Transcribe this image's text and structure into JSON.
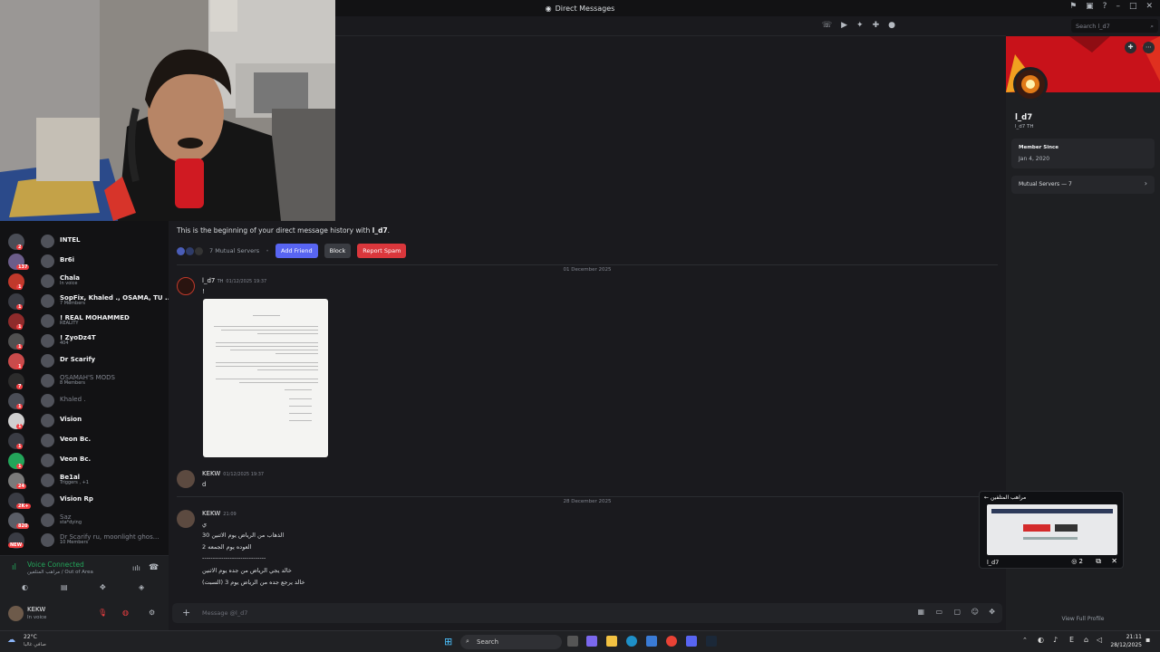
{
  "window": {
    "title": "Direct Messages"
  },
  "header": {
    "search_placeholder": "Search l_d7"
  },
  "sidebar": {
    "dms": [
      {
        "name": "INTEL",
        "status": "",
        "dim": false
      },
      {
        "name": "Br6i",
        "status": "",
        "dim": false
      },
      {
        "name": "Chala",
        "status": "In voice",
        "dim": false
      },
      {
        "name": "SopFix, Khaled ., OSAMA, TU ...",
        "status": "7 Members",
        "dim": false
      },
      {
        "name": "! REAL MOHAMMED",
        "status": "REALITY",
        "dim": false
      },
      {
        "name": "! ZyoDz4T",
        "status": "404",
        "dim": false
      },
      {
        "name": "Dr Scarify",
        "status": "",
        "dim": false
      },
      {
        "name": "OSAMAH'S MODS",
        "status": "8 Members",
        "dim": true
      },
      {
        "name": "Khaled .",
        "status": "",
        "dim": true
      },
      {
        "name": "Vision",
        "status": "",
        "dim": false
      },
      {
        "name": "Veon Bc.",
        "status": "",
        "dim": false
      },
      {
        "name": "Veon Bc.",
        "status": "",
        "dim": false
      },
      {
        "name": "Be1al",
        "status": "Triggers , +1",
        "dim": false
      },
      {
        "name": "Vision Rp",
        "status": "",
        "dim": false
      },
      {
        "name": "Saz",
        "status": "sta*dying",
        "dim": true
      },
      {
        "name": "Dr Scarify ru, moonlight ghos...",
        "status": "10 Members",
        "dim": true
      }
    ],
    "badges": [
      "2",
      "137",
      "1",
      "1",
      "1",
      "1",
      "1",
      "7",
      "1",
      "1",
      "1",
      "1",
      "24",
      "2K+",
      "820"
    ],
    "new_label": "NEW"
  },
  "voice": {
    "status": "Voice Connected",
    "channel": "مراهب المتلفين / Out of Area"
  },
  "user": {
    "name": "KEKW",
    "status": "In voice"
  },
  "chat": {
    "intro_prefix": "This is the beginning of your direct message history with ",
    "intro_name": "l_d7",
    "mutual_servers": "7 Mutual Servers",
    "add_friend": "Add Friend",
    "block": "Block",
    "report_spam": "Report Spam",
    "divider1": "01 December 2025",
    "divider2": "28 December 2025",
    "msg1": {
      "author": "l_d7",
      "tag": "TH",
      "time": "01/12/2025 19:37",
      "body": "!"
    },
    "msg2": {
      "author": "KEKW",
      "time": "01/12/2025 19:37",
      "body": "d"
    },
    "msg3": {
      "author": "KEKW",
      "time": "21:09",
      "lines": [
        "ي",
        "الذهاب من الرياض يوم الاثنين 30",
        "العوده يوم الجمعه 2",
        "------------------------------",
        "خالد يجي الرياض من جده يوم الاثنين",
        "خالد يرجع جده من الرياض يوم 3 (السبت)"
      ]
    },
    "composer_placeholder": "Message @l_d7"
  },
  "profile": {
    "name": "l_d7",
    "tag_line": "l_d7  TH",
    "member_since_label": "Member Since",
    "member_since_value": "Jan 4, 2020",
    "mutual_servers": "Mutual Servers — 7",
    "view_full": "View Full Profile"
  },
  "pip": {
    "title": "مراهب المتلفين",
    "user": "l_d7",
    "viewers": "2"
  },
  "taskbar": {
    "weather_temp": "22°C",
    "weather_desc": "صافي غالبا",
    "search": "Search",
    "time": "21:11",
    "date": "28/12/2025"
  }
}
